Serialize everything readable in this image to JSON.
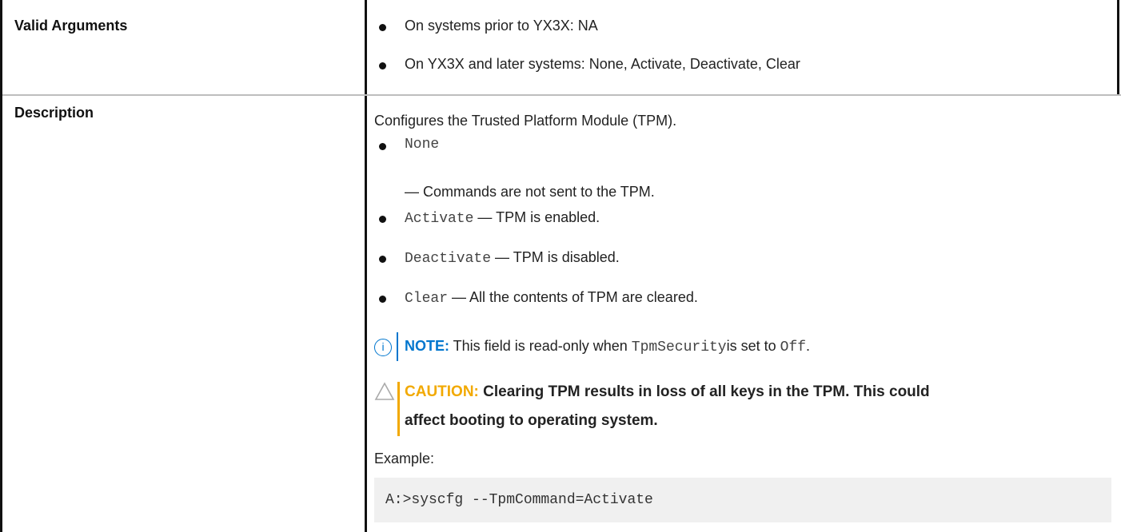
{
  "rows": {
    "valid_arguments": {
      "label": "Valid Arguments",
      "items": [
        "On systems prior to YX3X: NA",
        "On YX3X and later systems: None, Activate, Deactivate, Clear"
      ]
    },
    "description": {
      "label": "Description",
      "intro": "Configures the Trusted Platform Module (TPM).",
      "options": [
        {
          "code": "None",
          "text": "— Commands are not sent to the TPM."
        },
        {
          "code": "Activate",
          "text": " — TPM is enabled."
        },
        {
          "code": "Deactivate",
          "text": " — TPM is disabled."
        },
        {
          "code": "Clear",
          "text": " — All the contents of TPM are cleared."
        }
      ],
      "note": {
        "icon": "info-icon",
        "label": "NOTE:",
        "text_before": " This field is read-only when ",
        "code1": "TpmSecurity",
        "text_middle": "is set to ",
        "code2": "Off",
        "text_after": "."
      },
      "caution": {
        "icon": "warning-triangle-icon",
        "label": "CAUTION:",
        "line1": " Clearing TPM results in loss of all keys in the TPM. This could",
        "line2": "affect booting to operating system."
      },
      "example_label": "Example:",
      "example_code": "A:>syscfg --TpmCommand=Activate"
    }
  },
  "colors": {
    "note_accent": "#0076ce",
    "caution_accent": "#f2a900",
    "code_background": "#f0f0f0"
  }
}
